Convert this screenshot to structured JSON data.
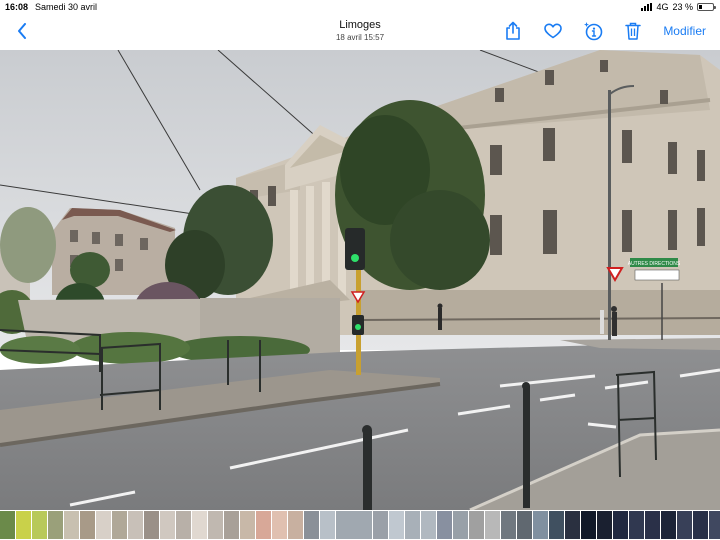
{
  "status_bar": {
    "time": "16:08",
    "date": "Samedi 30 avril",
    "network": "4G",
    "battery": "23 %",
    "battery_level": 0.23
  },
  "nav": {
    "title": "Limoges",
    "subtitle": "18 avril  15:57",
    "edit_label": "Modifier",
    "accent_color": "#1a7cf3",
    "icons": [
      "chevron-left-icon",
      "share-icon",
      "heart-icon",
      "info-sparkle-icon",
      "trash-icon"
    ]
  },
  "photo": {
    "signs": {
      "directions": "AUTRES DIRECTIONS"
    }
  },
  "thumbnails": [
    "#6b8a4a",
    "#c9d14a",
    "#b8c95a",
    "#9aa07a",
    "#c8c0b0",
    "#a89a88",
    "#d8d0c8",
    "#b0a898",
    "#c8c0b8",
    "#9a9088",
    "#d0c8c0",
    "#b8b0a8",
    "#e0d8d0",
    "#c0b8b0",
    "#a8a098",
    "#c8b8a8",
    "#d8a898",
    "#e0c0b0",
    "#c8b0a0",
    "#8a9098",
    "#b8c0c8",
    "#a0a8b0",
    "#9aa0a8",
    "#c0c8d0",
    "#a8b0b8",
    "#b0b8c0",
    "#8890a0",
    "#98a0a8",
    "#a0a0a0",
    "#b8b8b8",
    "#707880",
    "#606870",
    "#8090a0",
    "#405060",
    "#2a3040",
    "#101828",
    "#1a2030",
    "#202840",
    "#303850",
    "#2a3048",
    "#1c2438",
    "#384058",
    "#283048",
    "#404860",
    "#303040",
    "#202030"
  ],
  "selected_thumbnail": 21
}
